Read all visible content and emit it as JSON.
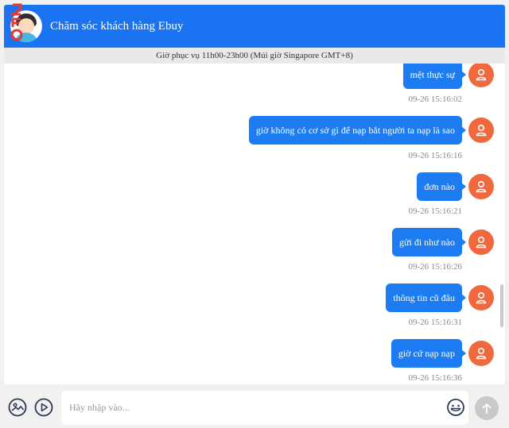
{
  "header": {
    "title": "Chăm sóc khách hàng Ebuy",
    "accent": "#1a73f0"
  },
  "hours_notice": "Giờ phục vụ 11h00-23h00 (Múi giờ Singapore GMT+8)",
  "messages": [
    {
      "text": "mệt thực sự",
      "time": "09-26 15:16:02"
    },
    {
      "text": "giờ không có cơ sở gì để nạp bắt người ta nạp là sao",
      "time": "09-26 15:16:16"
    },
    {
      "text": "đơn nào",
      "time": "09-26 15:16:21"
    },
    {
      "text": "gửi đi như nào",
      "time": "09-26 15:16:26"
    },
    {
      "text": "thông tin cũ đâu",
      "time": "09-26 15:16:31"
    },
    {
      "text": "giờ cứ nạp nạp",
      "time": "09-26 15:16:36"
    }
  ],
  "composer": {
    "placeholder": "Hãy nhập vào..."
  },
  "icons": {
    "image": "image-icon",
    "video": "play-icon",
    "emoji": "smiley-icon",
    "send": "arrow-up-icon",
    "user": "user-icon"
  },
  "colors": {
    "bubble": "#1e7cf2",
    "user_avatar": "#f0683d",
    "send_disabled": "#c9c9c9"
  }
}
